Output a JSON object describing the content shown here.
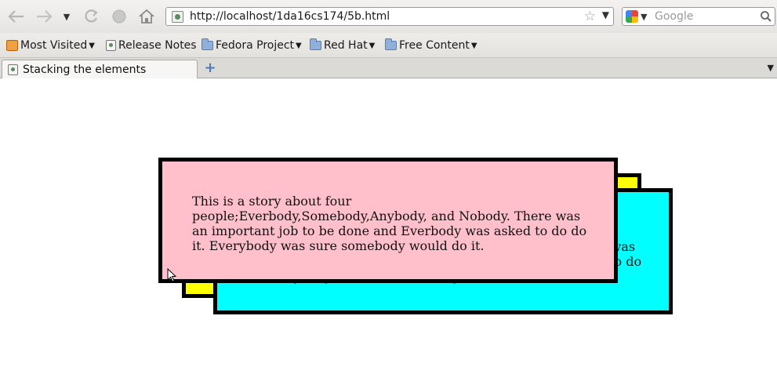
{
  "nav": {
    "url": "http://localhost/1da16cs174/5b.html",
    "search_placeholder": "Google"
  },
  "bookmarks": [
    {
      "label": "Most Visited",
      "icon": "most-visited-icon",
      "dropdown": true
    },
    {
      "label": "Release Notes",
      "icon": "page-icon",
      "dropdown": false
    },
    {
      "label": "Fedora Project",
      "icon": "folder-icon",
      "dropdown": true
    },
    {
      "label": "Red Hat",
      "icon": "folder-icon",
      "dropdown": true
    },
    {
      "label": "Free Content",
      "icon": "folder-icon",
      "dropdown": true
    }
  ],
  "tabs": [
    {
      "label": "Stacking the elements",
      "active": true
    }
  ],
  "page": {
    "story": "This is a story about four people;Everbody,Somebody,Anybody, and Nobody. There was an important job to be done and Everbody was asked to do do it. Everybody was sure somebody would do it.",
    "colors": {
      "box_front": "#ffc0cb",
      "box_middle": "#00ffff",
      "box_back": "#ffff00",
      "border": "#000000"
    }
  }
}
